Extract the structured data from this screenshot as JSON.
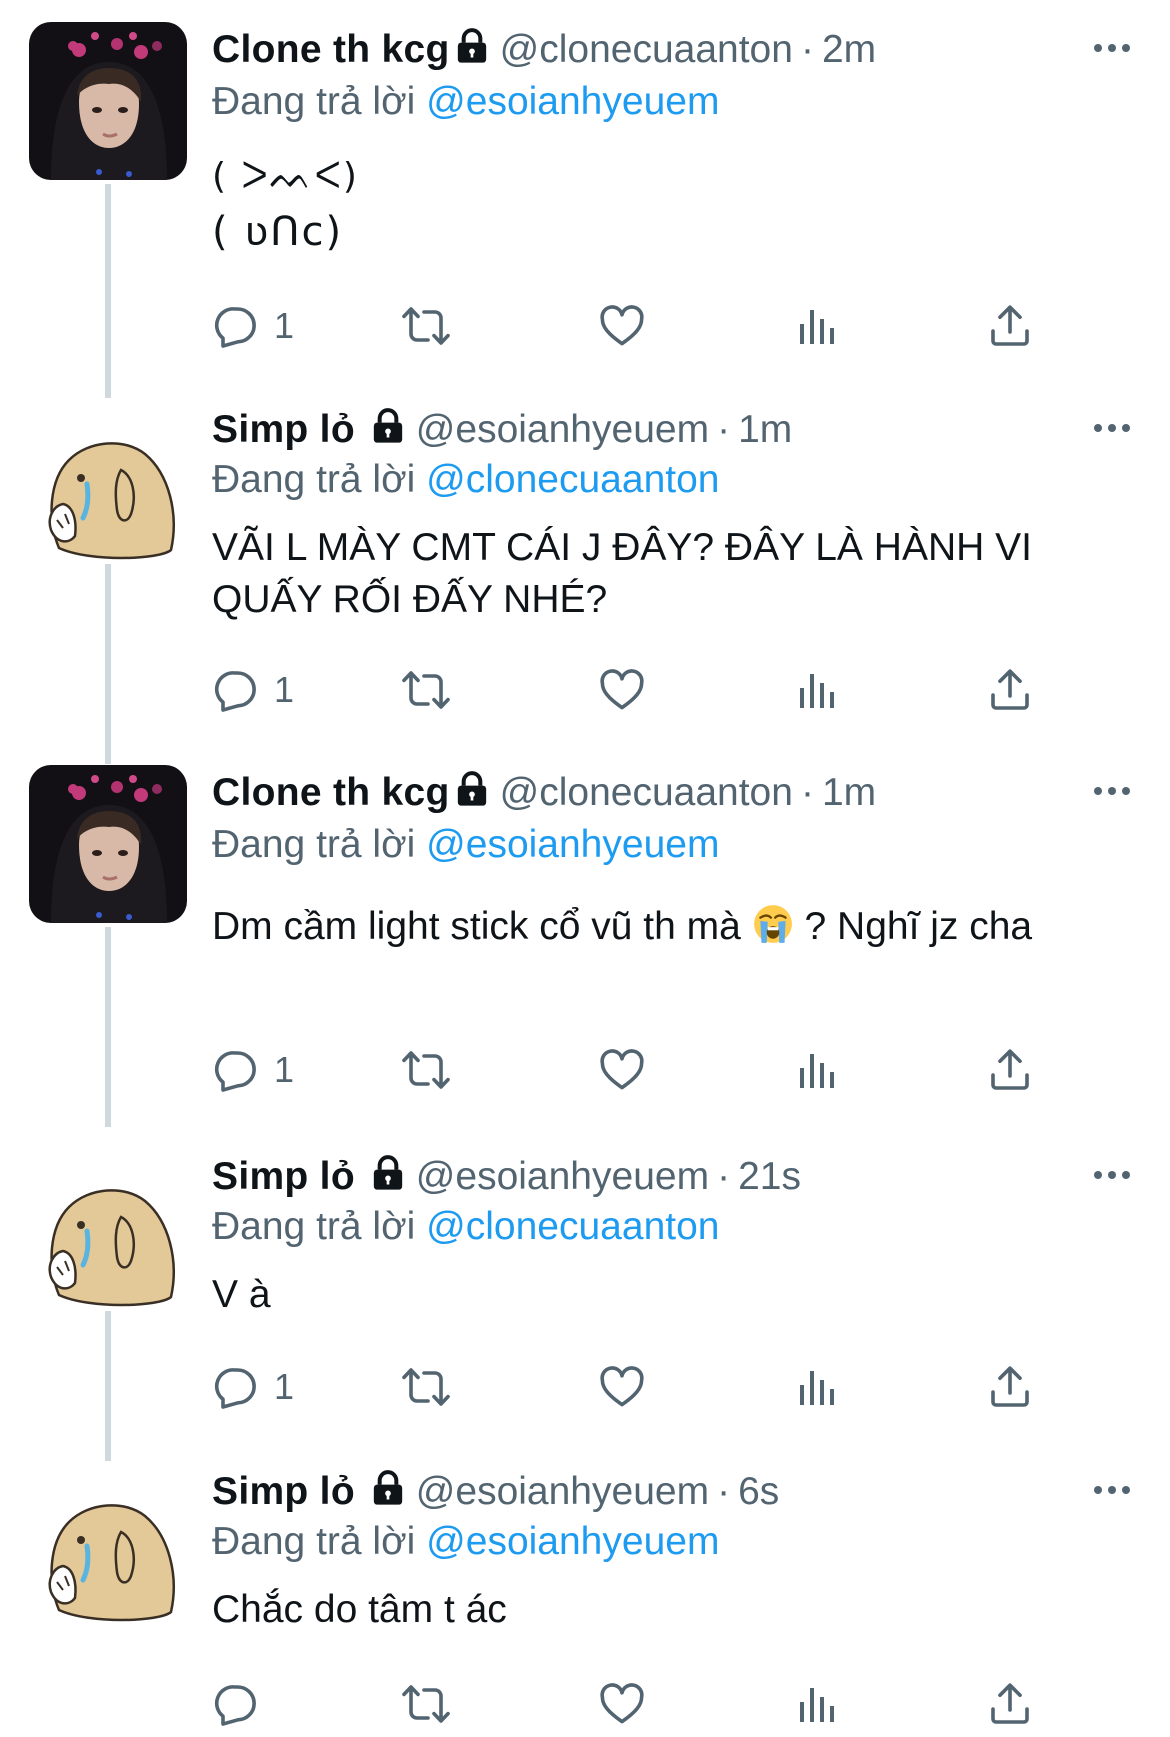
{
  "tweets": [
    {
      "name": "Clone th kcg",
      "handle": "@clonecuaanton",
      "time": "2m",
      "replying_prefix": "Đang trả lời",
      "replying_to": "@esoianhyeuem",
      "text_line1": "( ᐳᨓᐸ)",
      "text_line2": "( ʋᑎc)",
      "reply_count": "1",
      "avatar": "dark-hood-avatar"
    },
    {
      "name": "Simp lỏ",
      "handle": "@esoianhyeuem",
      "time": "1m",
      "replying_prefix": "Đang trả lời",
      "replying_to": "@clonecuaanton",
      "text": "VÃI L MÀY CMT CÁI J ĐÂY? ĐÂY LÀ HÀNH VI QUẤY RỐI ĐẤY NHÉ?",
      "reply_count": "1",
      "avatar": "crying-dog-avatar"
    },
    {
      "name": "Clone th kcg",
      "handle": "@clonecuaanton",
      "time": "1m",
      "replying_prefix": "Đang trả lời",
      "replying_to": "@esoianhyeuem",
      "text_before_emoji": "Dm cầm light stick cổ vũ th mà",
      "text_after_emoji": "? Nghĩ jz cha",
      "reply_count": "1",
      "avatar": "dark-hood-avatar"
    },
    {
      "name": "Simp lỏ",
      "handle": "@esoianhyeuem",
      "time": "21s",
      "replying_prefix": "Đang trả lời",
      "replying_to": "@clonecuaanton",
      "text": "V à",
      "reply_count": "1",
      "avatar": "crying-dog-avatar"
    },
    {
      "name": "Simp lỏ",
      "handle": "@esoianhyeuem",
      "time": "6s",
      "replying_prefix": "Đang trả lời",
      "replying_to": "@esoianhyeuem",
      "text": "Chắc do tâm t ác",
      "reply_count": "",
      "avatar": "crying-dog-avatar"
    }
  ],
  "colors": {
    "text": "#0f1419",
    "secondary": "#536471",
    "link": "#1d9bf0",
    "thread_line": "#cfd9de",
    "dog": "#e3c898"
  },
  "icons": [
    "lock-icon",
    "more-icon",
    "reply-icon",
    "retweet-icon",
    "like-icon",
    "views-icon",
    "share-icon",
    "loudly-crying-emoji"
  ]
}
